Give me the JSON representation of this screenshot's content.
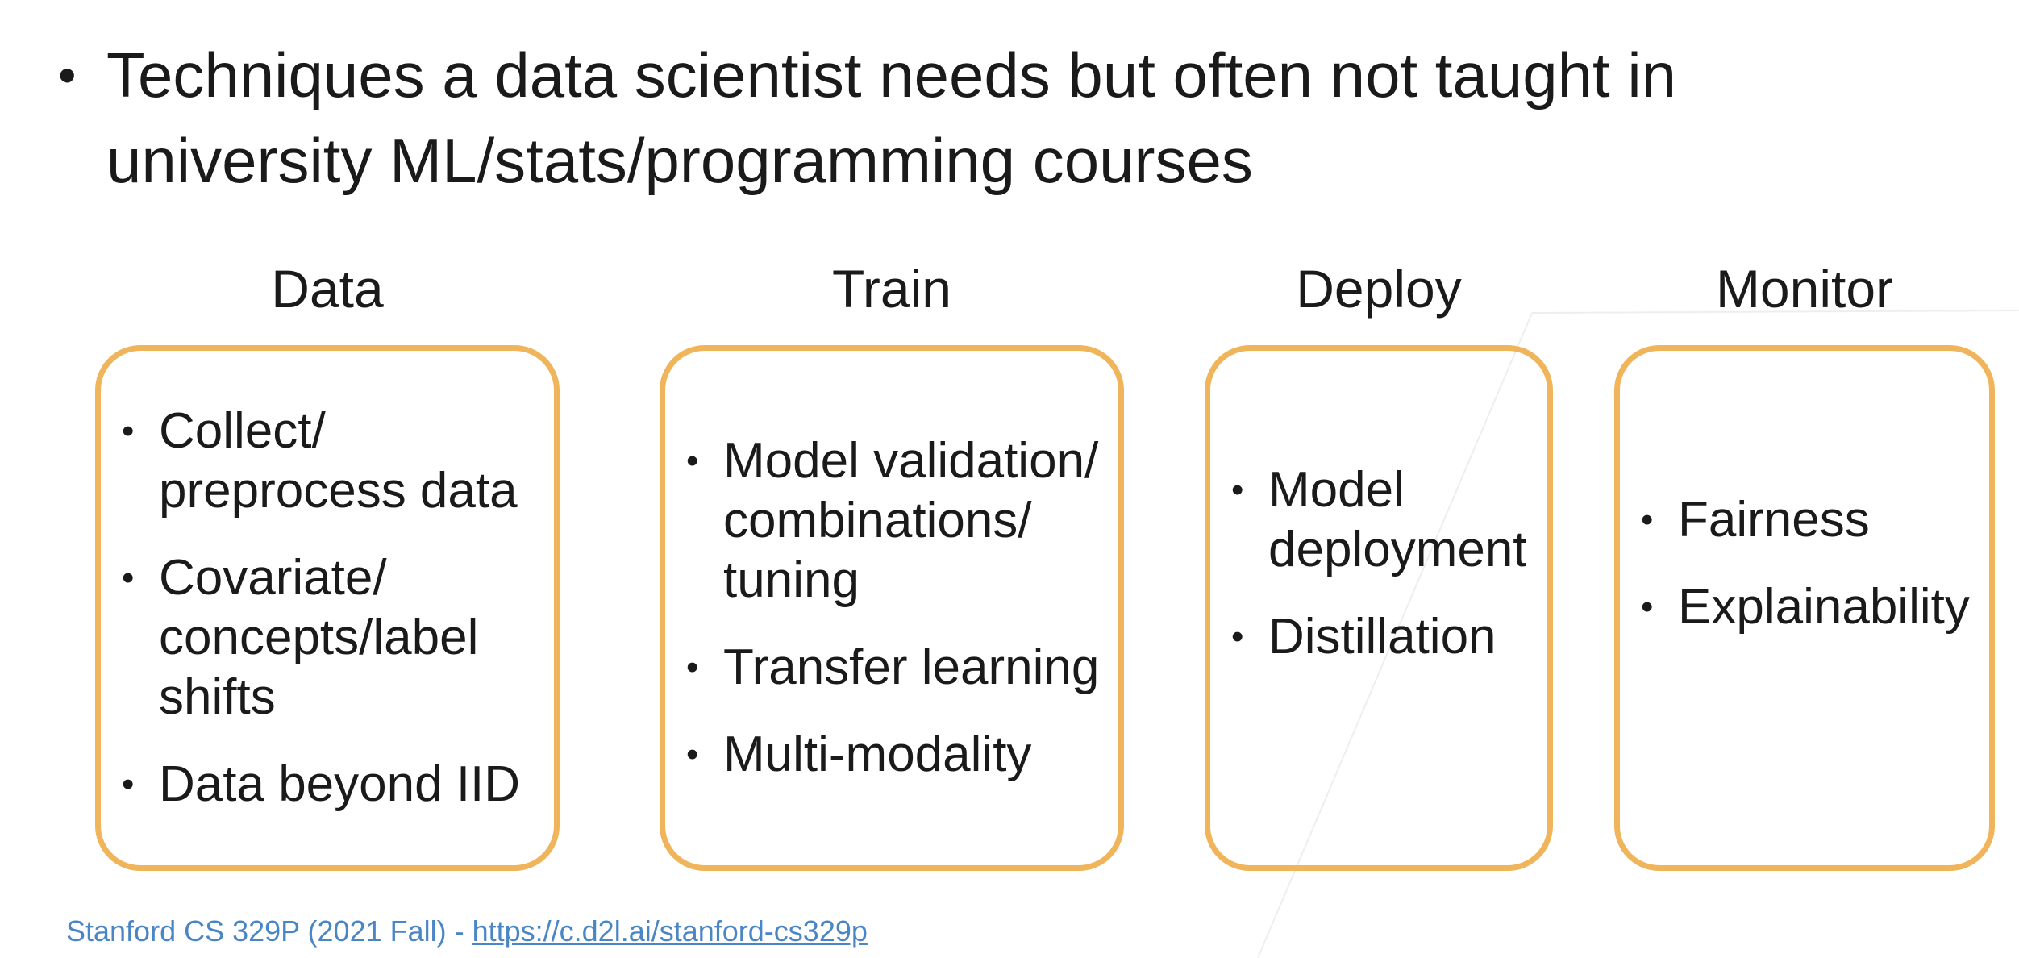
{
  "slide": {
    "main_bullet": "Techniques a data scientist needs but often not taught in university ML/stats/programming courses",
    "bullet_glyph": "•",
    "columns": [
      {
        "title": "Data",
        "items": [
          "Collect/ preprocess data",
          "Covariate/ concepts/label shifts",
          "Data beyond IID"
        ]
      },
      {
        "title": "Train",
        "items": [
          "Model validation/ combinations/ tuning",
          "Transfer learning",
          "Multi-modality"
        ]
      },
      {
        "title": "Deploy",
        "items": [
          "Model deployment",
          "Distillation"
        ]
      },
      {
        "title": "Monitor",
        "items": [
          "Fairness",
          "Explainability"
        ]
      }
    ],
    "footer": {
      "prefix": "Stanford CS 329P (2021 Fall) - ",
      "link_text": "https://c.d2l.ai/stanford-cs329p"
    }
  },
  "colors": {
    "box_border": "#f0b55a",
    "footer_link": "#4a86c5",
    "text": "#1a1a1a"
  }
}
